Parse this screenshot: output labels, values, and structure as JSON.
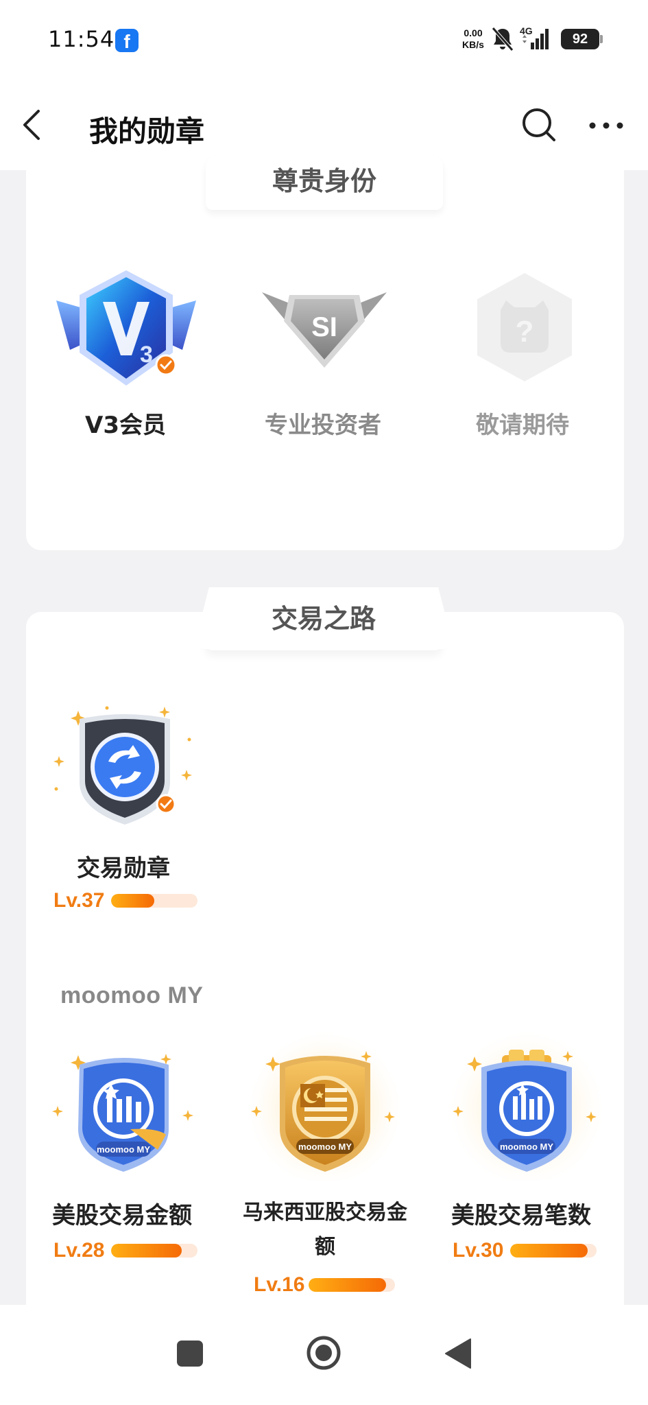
{
  "status_bar": {
    "time": "11:54",
    "app_icon": "facebook-icon",
    "net_speed_value": "0.00",
    "net_speed_unit": "KB/s",
    "network": "4G",
    "battery": "92"
  },
  "header": {
    "title": "我的勋章",
    "back_icon": "back-arrow-icon",
    "search_icon": "search-icon",
    "more_icon": "more-icon"
  },
  "sections": {
    "identity": {
      "title": "尊贵身份",
      "badges": [
        {
          "name": "V3会员",
          "emblem": "V3",
          "earned": true
        },
        {
          "name": "专业投资者",
          "emblem": "SI",
          "earned": false
        },
        {
          "name": "敬请期待",
          "emblem": "?",
          "earned": false
        }
      ]
    },
    "trading": {
      "title": "交易之路",
      "main_badge": {
        "name": "交易勋章",
        "level": "Lv.37",
        "progress": 0.5,
        "earned": true
      },
      "group_label": "moomoo MY",
      "emblem_text": "moomoo MY",
      "badges": [
        {
          "name": "美股交易金额",
          "level": "Lv.28",
          "progress": 0.82
        },
        {
          "name_line1": "马来西亚股交易金",
          "name_line2": "额",
          "level": "Lv.16",
          "progress": 0.9
        },
        {
          "name": "美股交易笔数",
          "level": "Lv.30",
          "progress": 0.9
        }
      ]
    }
  },
  "colors": {
    "accent": "#f07c13",
    "bar_track": "#fde8da",
    "page_bg": "#f2f2f4"
  },
  "bottom_nav": {
    "recents_icon": "square-icon",
    "home_icon": "circle-home-icon",
    "back_icon": "triangle-back-icon"
  }
}
